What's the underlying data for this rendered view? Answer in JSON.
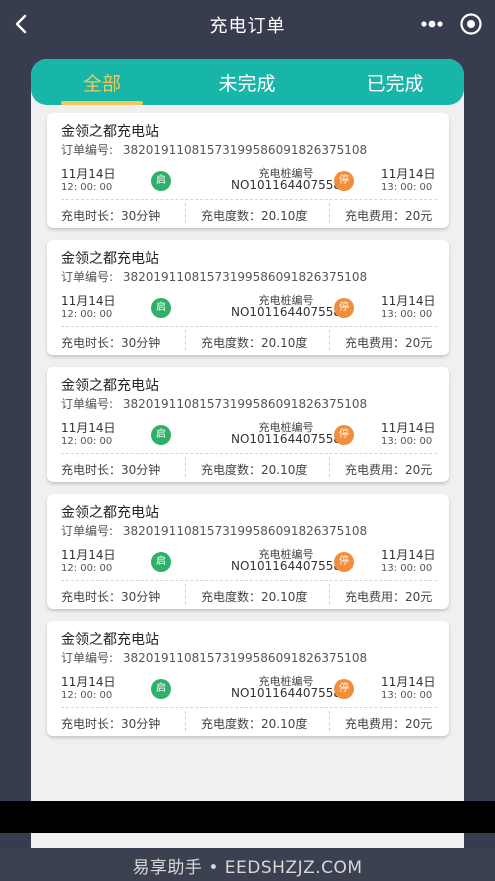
{
  "nav": {
    "title": "充电订单"
  },
  "tabs": [
    {
      "label": "全部",
      "active": true
    },
    {
      "label": "未完成",
      "active": false
    },
    {
      "label": "已完成",
      "active": false
    }
  ],
  "colors": {
    "accent": "#17b6a9",
    "active_tab": "#f3c85a",
    "start_badge": "#2fb06a",
    "stop_badge": "#f08e3c"
  },
  "orders": [
    {
      "station": "金领之都充电站",
      "order_label": "订单编号:",
      "order_no": "382019110815731995860918263751​08",
      "start_date": "11月14日",
      "start_time": "12: 00: 00",
      "start_badge": "启",
      "pile_label": "充电桩编号",
      "pile_no": "NO101164407558",
      "stop_badge": "停",
      "end_date": "11月14日",
      "end_time": "13: 00: 00",
      "duration": "充电时长：30分钟",
      "energy": "充电度数：20.10度",
      "fee": "充电费用：20元"
    },
    {
      "station": "金领之都充电站",
      "order_label": "订单编号:",
      "order_no": "38201911081573199586091826375108",
      "start_date": "11月14日",
      "start_time": "12: 00: 00",
      "start_badge": "启",
      "pile_label": "充电桩编号",
      "pile_no": "NO101164407558",
      "stop_badge": "停",
      "end_date": "11月14日",
      "end_time": "13: 00: 00",
      "duration": "充电时长：30分钟",
      "energy": "充电度数：20.10度",
      "fee": "充电费用：20元"
    },
    {
      "station": "金领之都充电站",
      "order_label": "订单编号:",
      "order_no": "38201911081573199586091826375108",
      "start_date": "11月14日",
      "start_time": "12: 00: 00",
      "start_badge": "启",
      "pile_label": "充电桩编号",
      "pile_no": "NO101164407558",
      "stop_badge": "停",
      "end_date": "11月14日",
      "end_time": "13: 00: 00",
      "duration": "充电时长：30分钟",
      "energy": "充电度数：20.10度",
      "fee": "充电费用：20元"
    },
    {
      "station": "金领之都充电站",
      "order_label": "订单编号:",
      "order_no": "38201911081573199586091826375108",
      "start_date": "11月14日",
      "start_time": "12: 00: 00",
      "start_badge": "启",
      "pile_label": "充电桩编号",
      "pile_no": "NO101164407558",
      "stop_badge": "停",
      "end_date": "11月14日",
      "end_time": "13: 00: 00",
      "duration": "充电时长：30分钟",
      "energy": "充电度数：20.10度",
      "fee": "充电费用：20元"
    },
    {
      "station": "金领之都充电站",
      "order_label": "订单编号:",
      "order_no": "38201911081573199586091826375108",
      "start_date": "11月14日",
      "start_time": "12: 00: 00",
      "start_badge": "启",
      "pile_label": "充电桩编号",
      "pile_no": "NO101164407558",
      "stop_badge": "停",
      "end_date": "11月14日",
      "end_time": "13: 00: 00",
      "duration": "充电时长：30分钟",
      "energy": "充电度数：20.10度",
      "fee": "充电费用：20元"
    }
  ],
  "watermark": "易享助手 • EEDSHZJZ.COM"
}
